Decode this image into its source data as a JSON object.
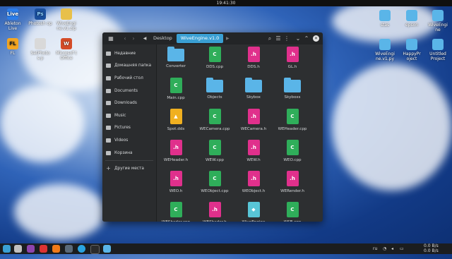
{
  "clock": "19:41:30",
  "desktop_left": [
    {
      "label": "Ableton Live",
      "icon": "live-icon",
      "badge": "Live",
      "color": "#2b7de9"
    },
    {
      "label": "Photosh op",
      "icon": "photoshop-icon",
      "badge": "Ps",
      "color": "#1b4f9c"
    },
    {
      "label": "WiveEngi ne.v1.zip",
      "icon": "zip-icon",
      "badge": "",
      "color": "#e8c04a"
    },
    {
      "label": "FL",
      "icon": "fl-studio-icon",
      "badge": "FL",
      "color": "#f4a623"
    },
    {
      "label": "SetPhoto s.p",
      "icon": "file-icon",
      "badge": "",
      "color": "#d9d9d9"
    },
    {
      "label": "Microsof t Office",
      "icon": "office-icon",
      "badge": "W",
      "color": "#d44c28"
    }
  ],
  "desktop_right": [
    {
      "label": "stas",
      "icon": "folder-icon"
    },
    {
      "label": "epson",
      "icon": "folder-icon"
    },
    {
      "label": "WiveEngi ne",
      "icon": "folder-icon"
    },
    {
      "label": "WiveEngi ne.v1.py",
      "icon": "folder-icon"
    },
    {
      "label": "HappyPr oject",
      "icon": "folder-icon"
    },
    {
      "label": "Untitled Project",
      "icon": "folder-icon"
    }
  ],
  "file_manager": {
    "breadcrumbs": [
      "Desktop",
      "WiveEngine.v1.0"
    ],
    "sidebar": [
      "Недавние",
      "Домашняя папка",
      "Рабочий стол",
      "Documents",
      "Downloads",
      "Music",
      "Pictures",
      "Videos",
      "Корзина",
      "Другие места"
    ],
    "files": [
      {
        "name": "Converter",
        "type": "folder"
      },
      {
        "name": "DDS.cpp",
        "type": "cpp"
      },
      {
        "name": "DDS.h",
        "type": "h"
      },
      {
        "name": "GL.h",
        "type": "h"
      },
      {
        "name": "Main.cpp",
        "type": "cpp"
      },
      {
        "name": "Objects",
        "type": "folder"
      },
      {
        "name": "Skybox",
        "type": "folder"
      },
      {
        "name": "Skyboxs",
        "type": "folder"
      },
      {
        "name": "Spot.dds",
        "type": "img"
      },
      {
        "name": "WECamera.cpp",
        "type": "cpp"
      },
      {
        "name": "WECamera.h",
        "type": "h"
      },
      {
        "name": "WEHeader.cpp",
        "type": "cpp"
      },
      {
        "name": "WEHeader.h",
        "type": "h"
      },
      {
        "name": "WEW.cpp",
        "type": "cpp"
      },
      {
        "name": "WEW.h",
        "type": "h"
      },
      {
        "name": "WEO.cpp",
        "type": "cpp"
      },
      {
        "name": "WEO.h",
        "type": "h"
      },
      {
        "name": "WEObject.cpp",
        "type": "cpp"
      },
      {
        "name": "WEObject.h",
        "type": "h"
      },
      {
        "name": "WERender.h",
        "type": "h"
      },
      {
        "name": "WEShader.cpp",
        "type": "cpp"
      },
      {
        "name": "WEShader.h",
        "type": "h"
      },
      {
        "name": "WiveEngine",
        "type": "bin"
      },
      {
        "name": "WSB.cpp",
        "type": "cpp"
      }
    ]
  },
  "taskbar": {
    "language": "ru",
    "net_up": "0.0 B/s",
    "net_down": "0.0 B/s"
  }
}
